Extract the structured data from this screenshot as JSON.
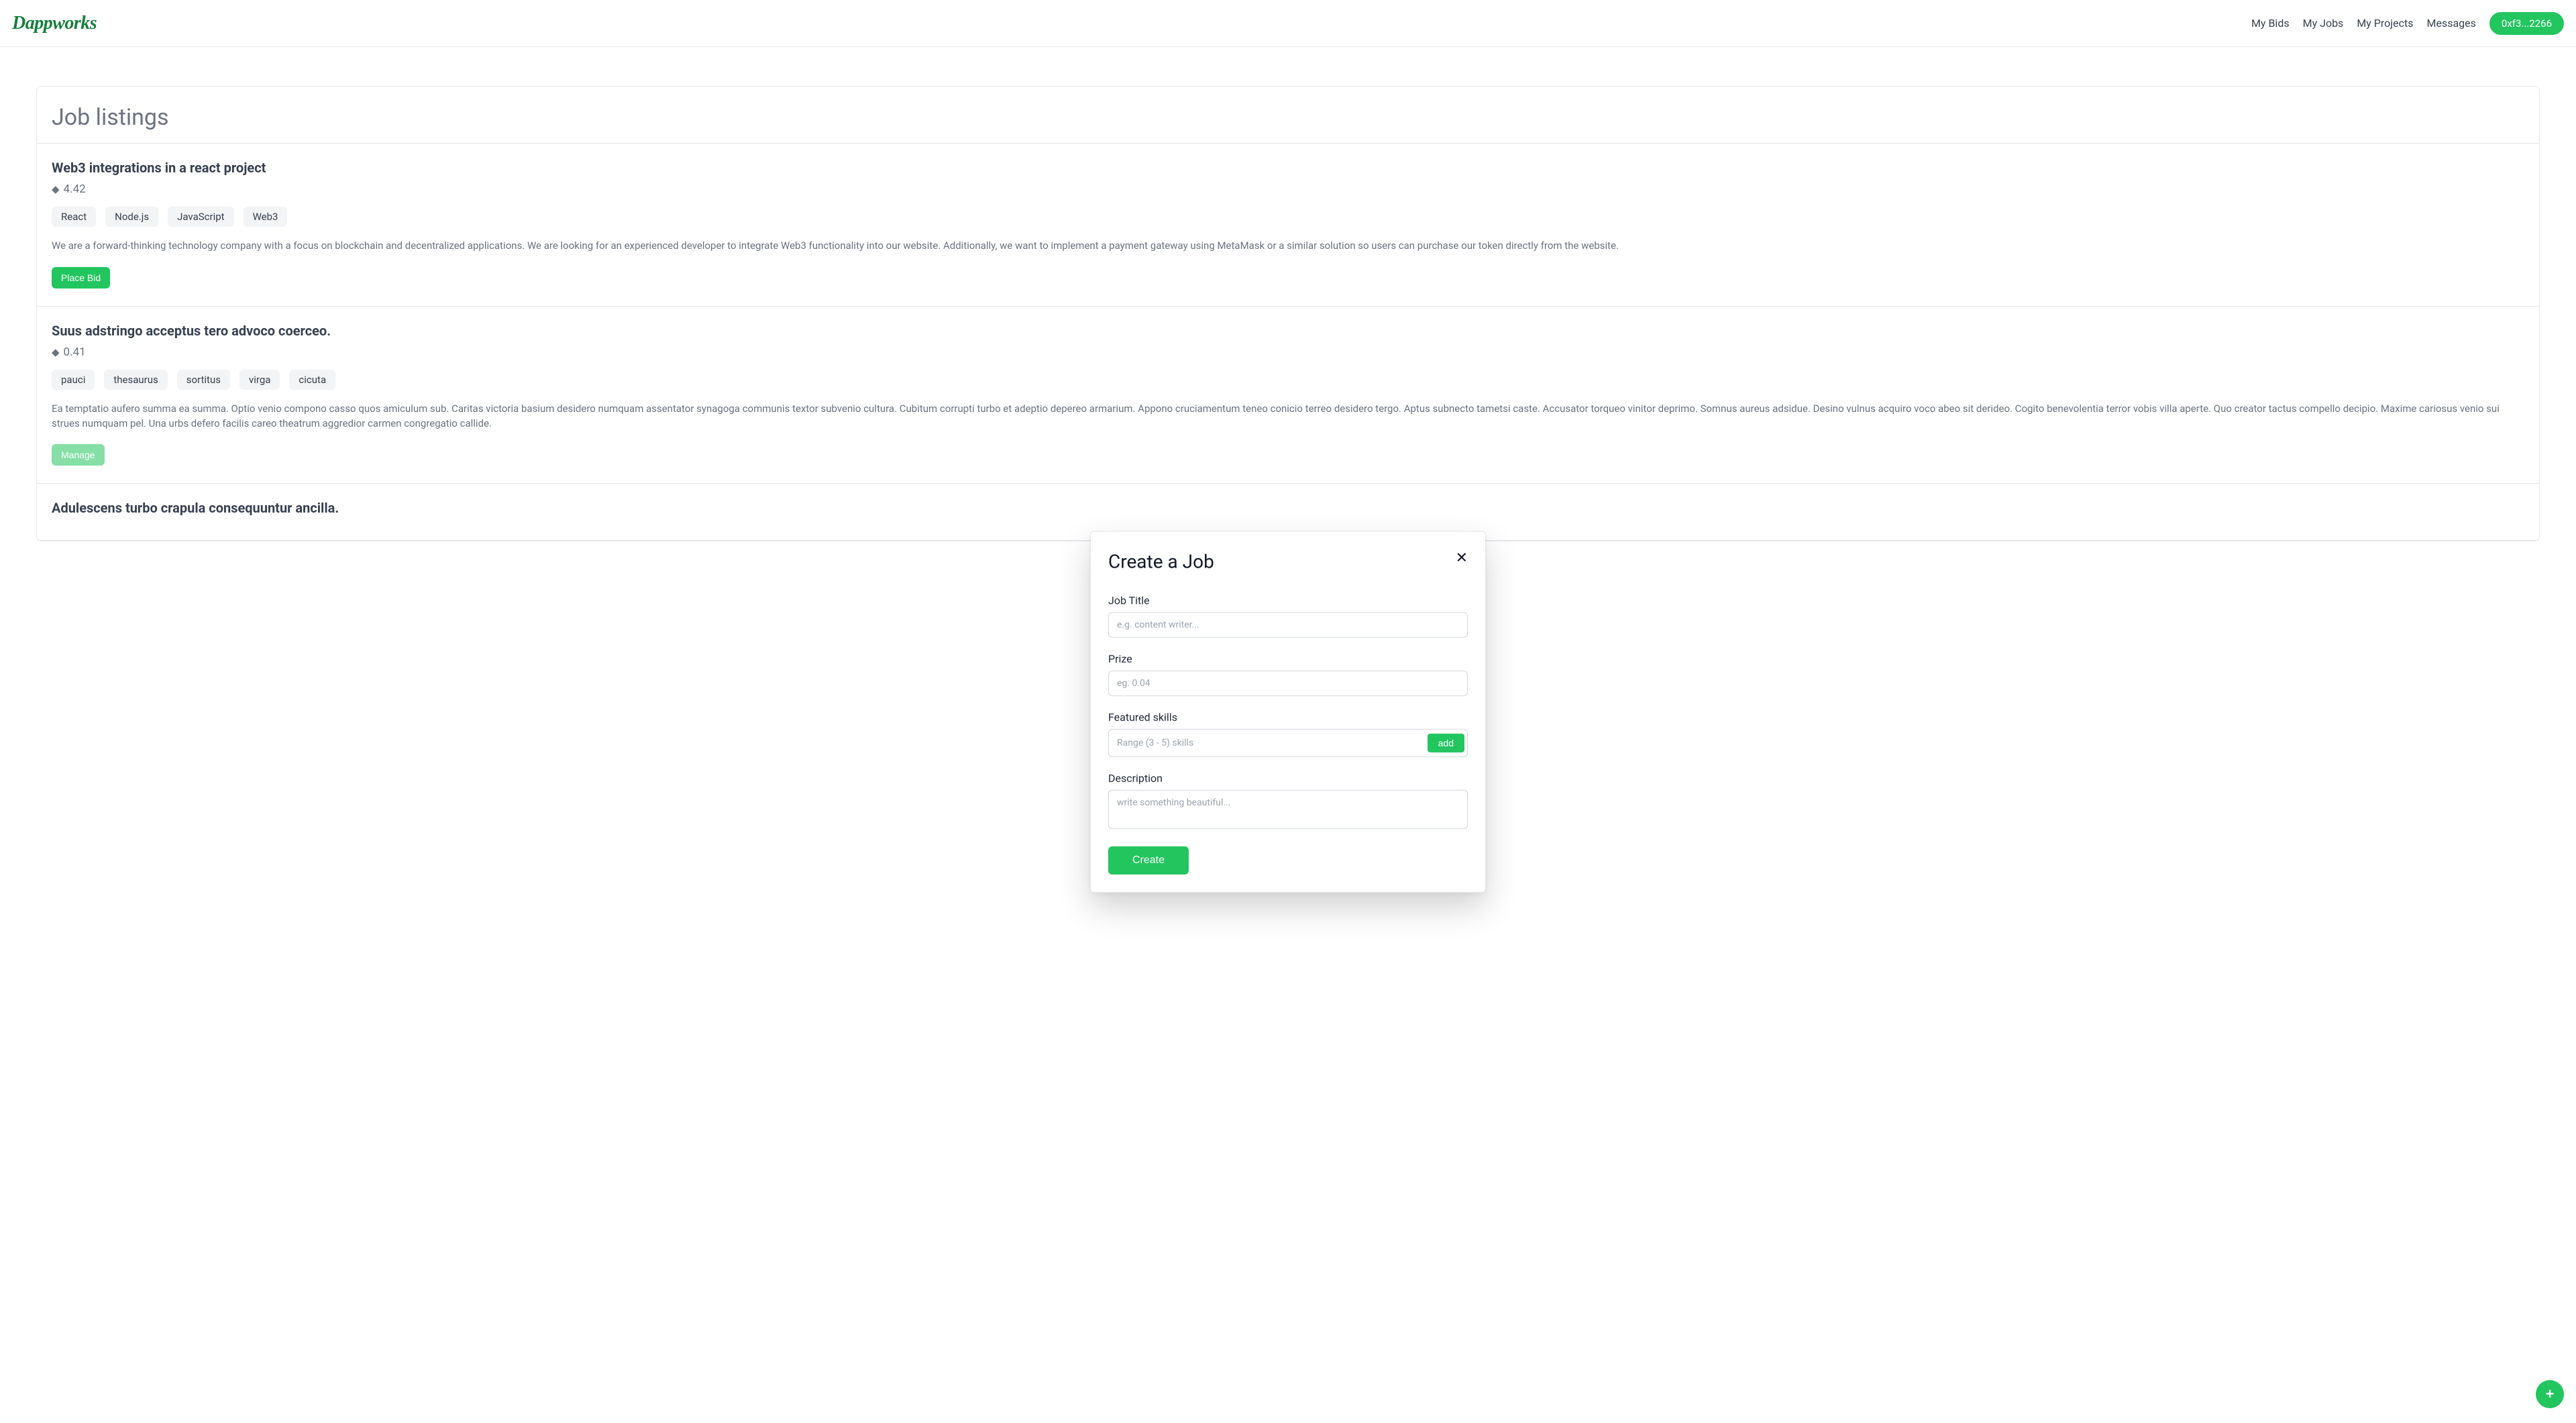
{
  "brand": "Dappworks",
  "nav": {
    "my_bids": "My Bids",
    "my_jobs": "My Jobs",
    "my_projects": "My Projects",
    "messages": "Messages",
    "wallet": "0xf3...2266"
  },
  "listings": {
    "heading": "Job listings"
  },
  "jobs": [
    {
      "title": "Web3 integrations in a react project",
      "price": "4.42",
      "skills": [
        "React",
        "Node.js",
        "JavaScript",
        "Web3"
      ],
      "description": "We are a forward-thinking technology company with a focus on blockchain and decentralized applications. We are looking for an experienced developer to integrate Web3 functionality into our website. Additionally, we want to implement a payment gateway using MetaMask or a similar solution so users can purchase our token directly from the website.",
      "action_label": "Place Bid",
      "action_kind": "bid"
    },
    {
      "title": "Suus adstringo acceptus tero advoco coerceo.",
      "price": "0.41",
      "skills": [
        "pauci",
        "thesaurus",
        "sortitus",
        "virga",
        "cicuta"
      ],
      "description": "Ea temptatio aufero summa ea summa. Optio venio compono casso quos amiculum sub. Caritas victoria basium desidero numquam assentator synagoga communis textor subvenio cultura. Cubitum corrupti turbo et adeptio depereo armarium. Appono cruciamentum teneo conicio terreo desidero tergo. Aptus subnecto tametsi caste. Accusator torqueo vinitor deprimo. Somnus aureus adsidue. Desino vulnus acquiro voco abeo sit derideo. Cogito benevolentia terror vobis villa aperte. Quo creator tactus compello decipio. Maxime cariosus venio sui strues numquam pel. Una urbs defero facilis careo theatrum aggredior carmen congregatio callide.",
      "action_label": "Manage",
      "action_kind": "manage"
    },
    {
      "title": "Adulescens turbo crapula consequuntur ancilla.",
      "price": "",
      "skills": [],
      "description": "",
      "action_label": "",
      "action_kind": ""
    }
  ],
  "modal": {
    "title": "Create a Job",
    "labels": {
      "job_title": "Job Title",
      "prize": "Prize",
      "featured_skills": "Featured skills",
      "description": "Description"
    },
    "placeholders": {
      "job_title": "e.g. content writer...",
      "prize": "eg. 0.04",
      "skills": "Range (3 - 5) skills",
      "description": "write something beautiful..."
    },
    "add_label": "add",
    "submit_label": "Create"
  },
  "icons": {
    "eth": "◆",
    "close": "✕",
    "plus": "+"
  },
  "colors": {
    "accent": "#22c55e",
    "brand": "#15803d"
  }
}
